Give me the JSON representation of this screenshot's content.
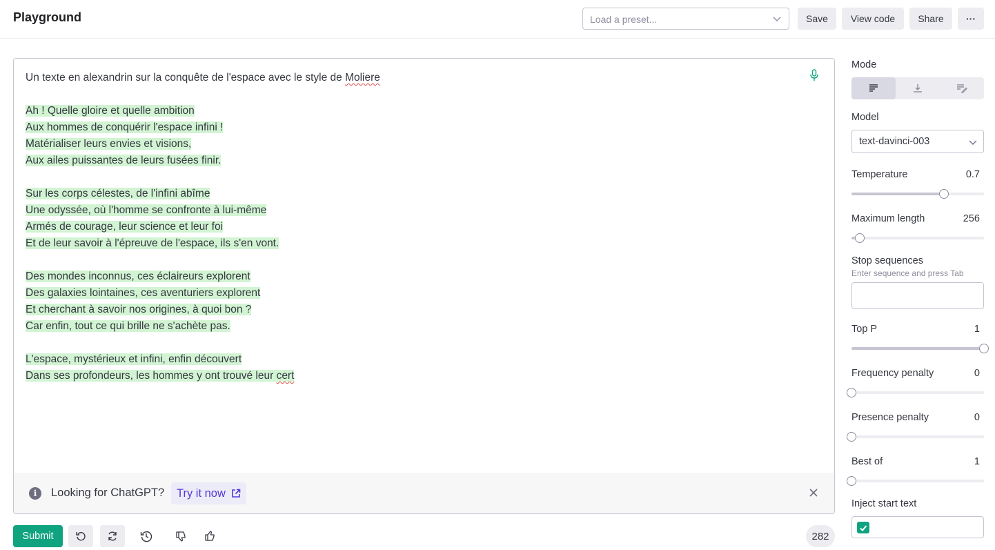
{
  "header": {
    "title": "Playground",
    "preset_placeholder": "Load a preset...",
    "save_label": "Save",
    "view_code_label": "View code",
    "share_label": "Share",
    "more_label": "···"
  },
  "editor": {
    "prompt_prefix": "Un texte en alexandrin sur la conquête de l'espace avec le style de ",
    "prompt_misspelled": "Moliere",
    "stanza1": [
      "Ah ! Quelle gloire et quelle ambition",
      "Aux hommes de conquérir l'espace infini !",
      "Matérialiser leurs envies et visions,",
      "Aux ailes puissantes de leurs fusées finir."
    ],
    "stanza2": [
      "Sur les corps célestes, de l'infini abîme",
      "Une odyssée, où l'homme se confronte à lui-même",
      "Armés de courage, leur science et leur foi",
      "Et de leur savoir à l'épreuve de l'espace, ils s'en vont."
    ],
    "stanza3": [
      "Des mondes inconnus, ces éclaireurs explorent",
      "Des galaxies lointaines, ces aventuriers explorent",
      "Et cherchant à savoir nos origines, à quoi bon ?",
      "Car enfin, tout ce qui brille ne s'achète pas."
    ],
    "stanza4_line1": "L'espace, mystérieux et infini, enfin découvert",
    "stanza4_line2_prefix": "Dans ses profondeurs, les hommes y ont trouvé leur ",
    "stanza4_line2_misspelled": "cert"
  },
  "banner": {
    "info_glyph": "i",
    "text": "Looking for ChatGPT?",
    "try_label": "Try it now"
  },
  "bottom": {
    "submit_label": "Submit",
    "token_count": "282"
  },
  "sidebar": {
    "mode_label": "Mode",
    "model_label": "Model",
    "model_value": "text-davinci-003",
    "temperature": {
      "label": "Temperature",
      "value": "0.7",
      "fraction": 0.7
    },
    "max_length": {
      "label": "Maximum length",
      "value": "256",
      "fraction": 0.06
    },
    "stop_label": "Stop sequences",
    "stop_hint": "Enter sequence and press Tab",
    "top_p": {
      "label": "Top P",
      "value": "1",
      "fraction": 1.0
    },
    "frequency_penalty": {
      "label": "Frequency penalty",
      "value": "0",
      "fraction": 0.0
    },
    "presence_penalty": {
      "label": "Presence penalty",
      "value": "0",
      "fraction": 0.0
    },
    "best_of": {
      "label": "Best of",
      "value": "1",
      "fraction": 0.0
    },
    "inject_start_label": "Inject start text",
    "inject_start_checked": true
  },
  "colors": {
    "accent": "#10a37f",
    "highlight": "#d2f4d3",
    "link": "#5436da"
  }
}
